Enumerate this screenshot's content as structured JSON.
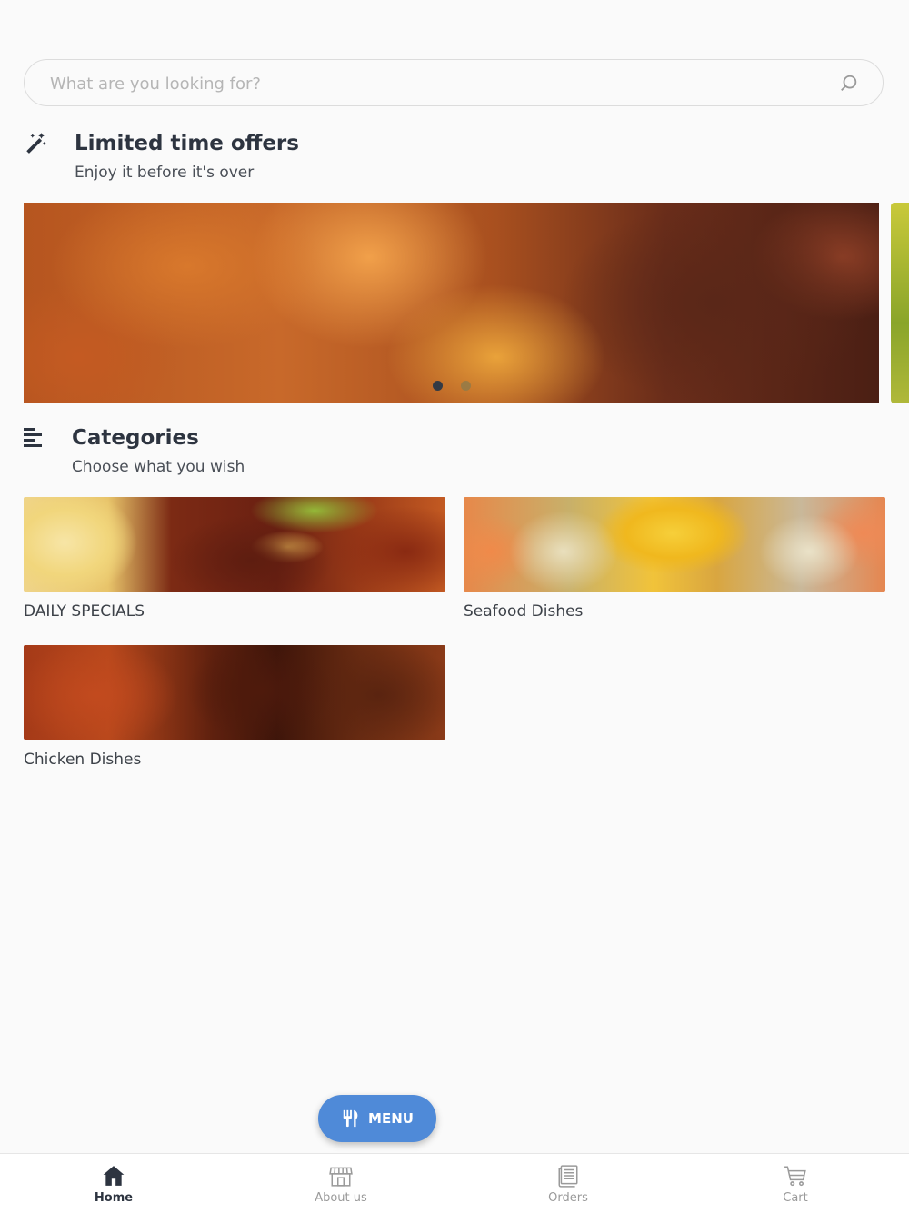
{
  "search": {
    "placeholder": "What are you looking for?",
    "icon": "search-icon"
  },
  "offers": {
    "icon": "magic-wand-icon",
    "title": "Limited time offers",
    "subtitle": "Enjoy it before it's over",
    "carousel": {
      "slide_count": 2,
      "active_index": 0
    }
  },
  "categories": {
    "icon": "list-lines-icon",
    "title": "Categories",
    "subtitle": "Choose what you wish",
    "items": [
      {
        "label": "DAILY SPECIALS"
      },
      {
        "label": "Seafood Dishes"
      },
      {
        "label": "Chicken Dishes"
      }
    ]
  },
  "fab": {
    "label": "MENU",
    "icon": "fork-knife-icon",
    "color": "#4f8ad8"
  },
  "bottom_nav": {
    "items": [
      {
        "label": "Home",
        "icon": "home-icon",
        "active": true
      },
      {
        "label": "About us",
        "icon": "store-icon",
        "active": false
      },
      {
        "label": "Orders",
        "icon": "orders-icon",
        "active": false
      },
      {
        "label": "Cart",
        "icon": "cart-icon",
        "active": false
      }
    ]
  }
}
